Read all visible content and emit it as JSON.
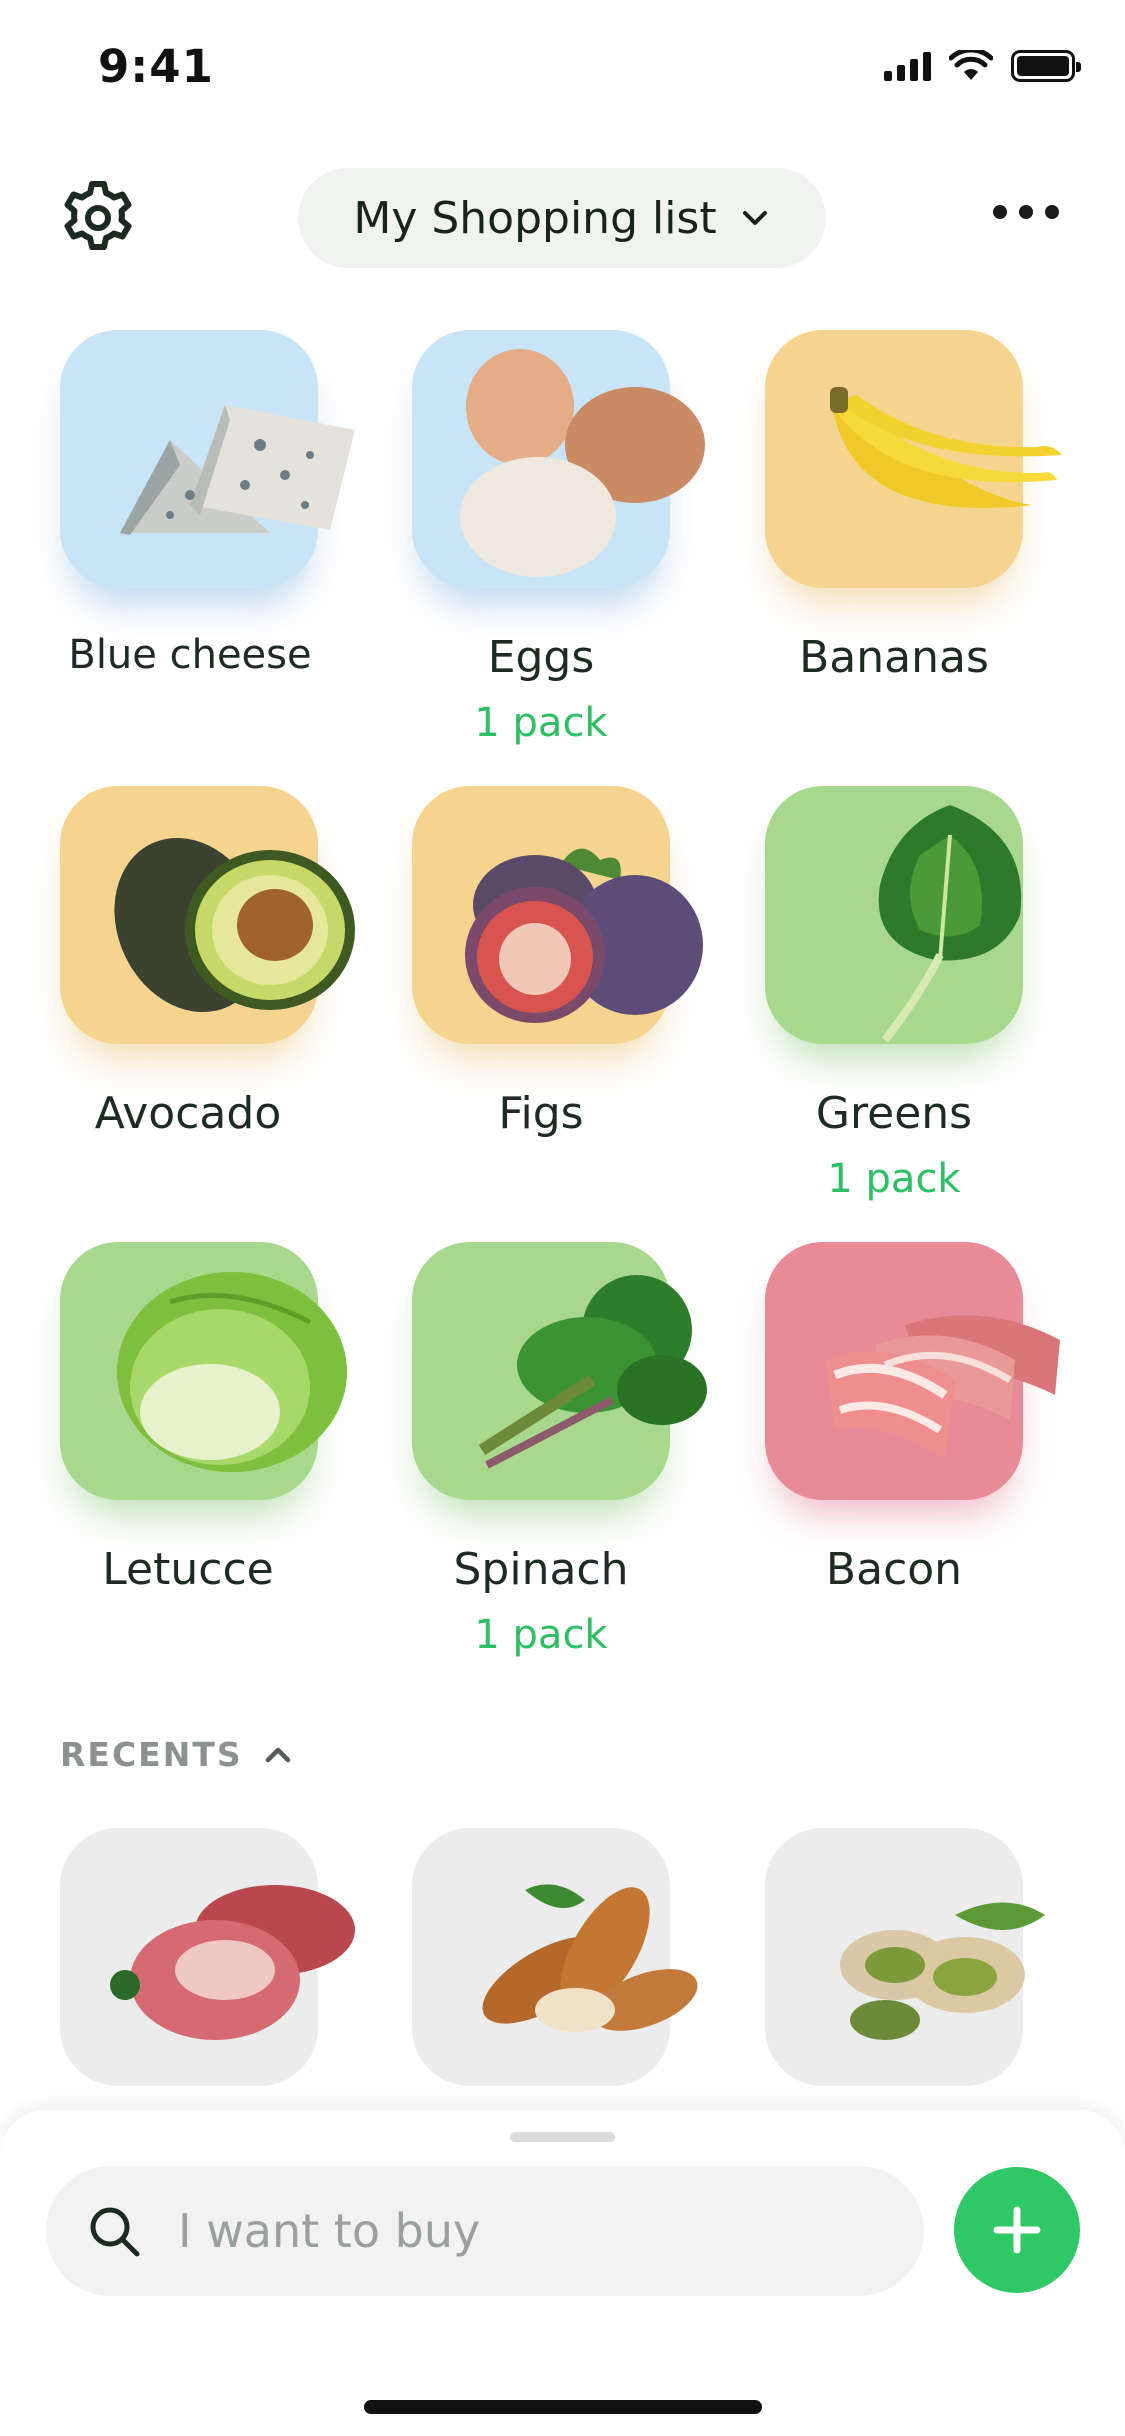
{
  "status_bar": {
    "time": "9:41"
  },
  "header": {
    "list_title": "My Shopping list",
    "settings_icon": "gear-icon",
    "more_icon": "more-dots-icon",
    "dropdown_icon": "chevron-down-icon"
  },
  "colors": {
    "accent_green": "#2ec867",
    "qty_green": "#2cbf63",
    "tile_blue": "#c9e3f7",
    "tile_yellow": "#f4d48f",
    "tile_green": "#a7d88e",
    "tile_red": "#e88a98",
    "tile_grey": "#ececec"
  },
  "items": [
    {
      "name": "Blue cheese",
      "qty": "",
      "tile": "blue",
      "icon": "blue-cheese-image"
    },
    {
      "name": "Eggs",
      "qty": "1 pack",
      "tile": "blue",
      "icon": "eggs-image"
    },
    {
      "name": "Bananas",
      "qty": "",
      "tile": "yellow",
      "icon": "bananas-image"
    },
    {
      "name": "Avocado",
      "qty": "",
      "tile": "yellow",
      "icon": "avocado-image"
    },
    {
      "name": "Figs",
      "qty": "",
      "tile": "yellow",
      "icon": "figs-image"
    },
    {
      "name": "Greens",
      "qty": "1 pack",
      "tile": "green",
      "icon": "greens-image"
    },
    {
      "name": "Letucce",
      "qty": "",
      "tile": "green",
      "icon": "lettuce-image"
    },
    {
      "name": "Spinach",
      "qty": "1 pack",
      "tile": "green",
      "icon": "spinach-image"
    },
    {
      "name": "Bacon",
      "qty": "",
      "tile": "red",
      "icon": "bacon-image"
    }
  ],
  "recents": {
    "title": "RECENTS",
    "toggle_icon": "chevron-up-icon",
    "items": [
      {
        "icon": "meat-image"
      },
      {
        "icon": "almonds-image"
      },
      {
        "icon": "pistachios-image"
      }
    ]
  },
  "search": {
    "placeholder": "I want to buy",
    "value": "",
    "icon": "search-icon"
  },
  "add_button": {
    "icon": "plus-icon"
  }
}
